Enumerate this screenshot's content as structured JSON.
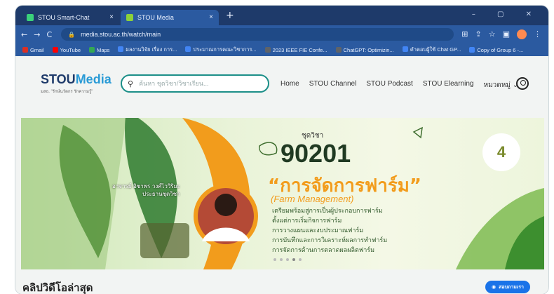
{
  "browser": {
    "tabs": [
      {
        "label": "STOU Smart-Chat",
        "close": "×"
      },
      {
        "label": "STOU Media",
        "close": "×"
      }
    ],
    "new_tab": "+",
    "window_controls": "–  ▢  ✕",
    "nav": {
      "back": "←",
      "forward": "→",
      "reload": "C"
    },
    "url": "media.stou.ac.th/watch/main",
    "bookmarks": [
      {
        "label": "Gmail",
        "color": "#d93025"
      },
      {
        "label": "YouTube",
        "color": "#ff0000"
      },
      {
        "label": "Maps",
        "color": "#34a853"
      },
      {
        "label": "ผลงานวิจัย เรื่อง การ...",
        "color": "#4285f4"
      },
      {
        "label": "ประมาณการคณะวิชาการ...",
        "color": "#4285f4"
      },
      {
        "label": "2023 IEEE FIE Confe...",
        "color": "#5f6368"
      },
      {
        "label": "ChatGPT: Optimizin...",
        "color": "#5f6368"
      },
      {
        "label": "คำตอบผู้ใช้ Chat GP...",
        "color": "#4285f4"
      },
      {
        "label": "Copy of Group 6 -...",
        "color": "#4285f4"
      }
    ]
  },
  "site": {
    "logo_main": "STOU",
    "logo_accent": "Media",
    "logo_tagline": "มสธ. \"รักษ์นวัตกร รักความรู้\"",
    "search_placeholder": "ค้นหา ชุดวิชา/วิชาเรียน...",
    "menu": [
      "Home",
      "STOU Channel",
      "STOU Podcast",
      "STOU Elearning",
      "หมวดหมู่ ⌄"
    ]
  },
  "banner": {
    "label": "ชุดวิชา",
    "course_code": "90201",
    "course_name_th": "“การจัดการฟาร์ม”",
    "course_name_en": "(Farm Management)",
    "topics": [
      "เตรียมพร้อมสู่การเป็นผู้ประกอบการฟาร์ม",
      "ตั้งแต่การเริ่มกิจการฟาร์ม",
      "การวางแผนและงบประมาณฟาร์ม",
      "การบันทึกและการวิเคราะห์ผลการทำฟาร์ม",
      "การจัดการด้านการตลาดผลผลิตฟาร์ม"
    ],
    "presenter_name": "อาจารย์ อิชาพร วงศ์ไววิริยะ",
    "presenter_role": "ประธานชุดวิชา",
    "anniversary": "4"
  },
  "section_title": "คลิปวิดีโอล่าสุด",
  "chat_button": "สอบถามเรา"
}
